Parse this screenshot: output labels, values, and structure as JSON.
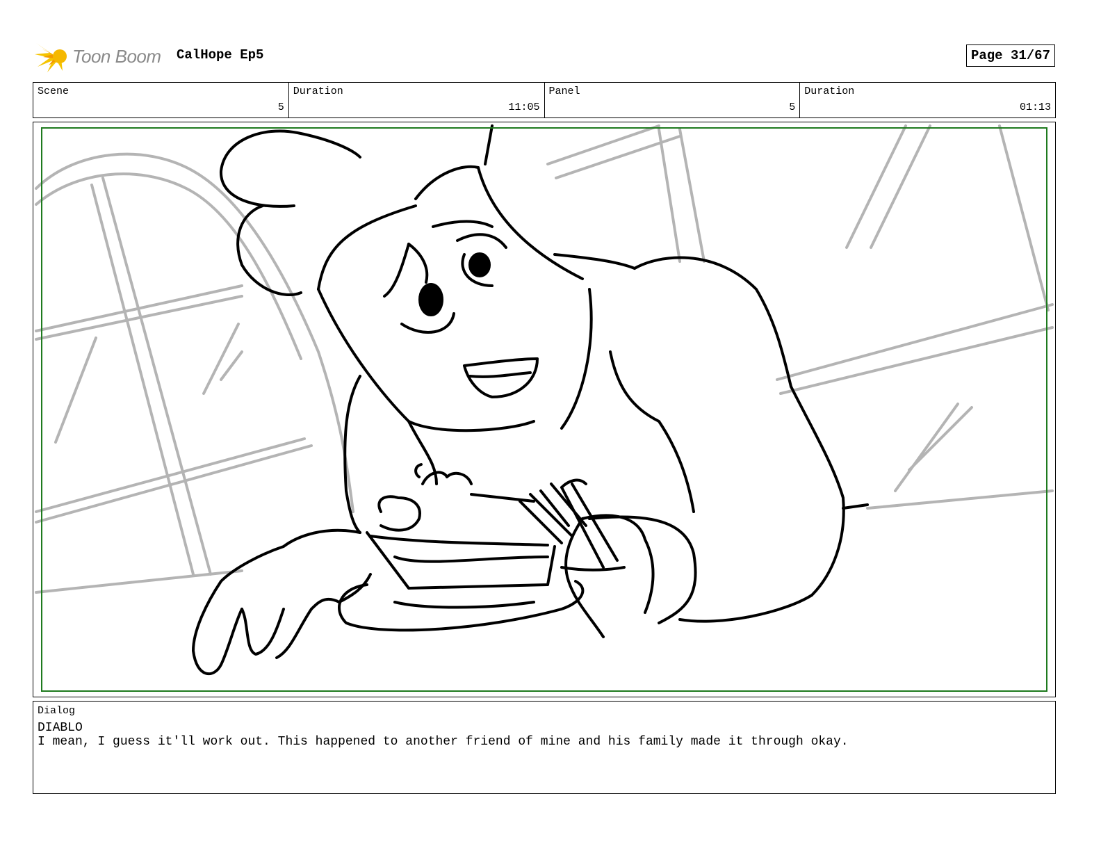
{
  "header": {
    "logo_text": "Toon Boom",
    "title": "CalHope Ep5",
    "page": "Page 31/67"
  },
  "info": {
    "scene_label": "Scene",
    "scene_value": "5",
    "scene_duration_label": "Duration",
    "scene_duration_value": "11:05",
    "panel_label": "Panel",
    "panel_value": "5",
    "panel_duration_label": "Duration",
    "panel_duration_value": "01:13"
  },
  "panel": {
    "safe_frame_color": "#1e7a1e"
  },
  "dialog": {
    "label": "Dialog",
    "speaker": "DIABLO",
    "line": "I mean, I guess it'll work out. This happened to another friend of mine and his family made it through okay."
  }
}
